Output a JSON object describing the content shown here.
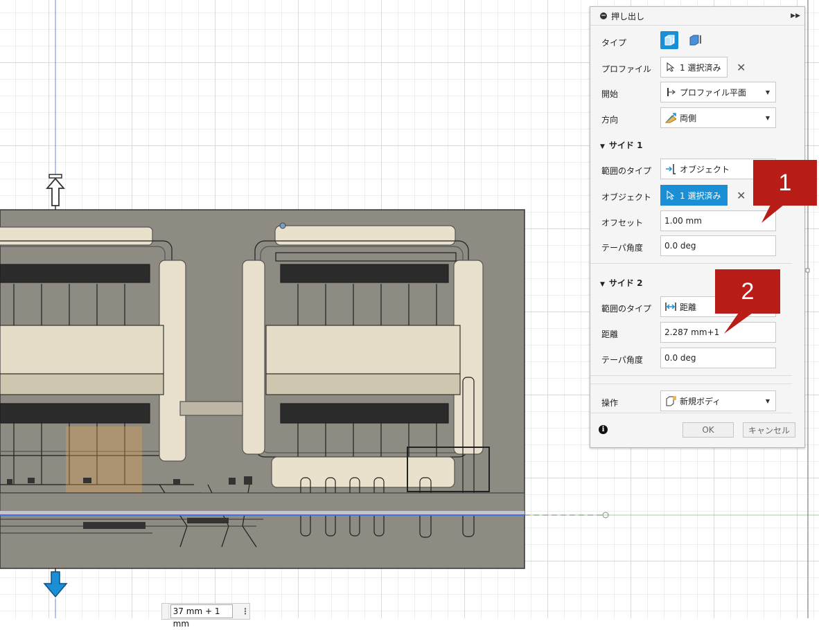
{
  "panel": {
    "title": "押し出し",
    "collapse_icon": "fast-forward-icon",
    "type_label": "タイプ",
    "profile_label": "プロファイル",
    "profile_value": "1 選択済み",
    "start_label": "開始",
    "start_value": "プロファイル平面",
    "direction_label": "方向",
    "direction_value": "両側",
    "side1": {
      "header": "サイド 1",
      "extent_type_label": "範囲のタイプ",
      "extent_type_value": "オブジェクト",
      "object_label": "オブジェクト",
      "object_value": "1 選択済み",
      "offset_label": "オフセット",
      "offset_value": "1.00 mm",
      "taper_label": "テーパ角度",
      "taper_value": "0.0 deg"
    },
    "side2": {
      "header": "サイド 2",
      "extent_type_label": "範囲のタイプ",
      "extent_type_value": "距離",
      "distance_label": "距離",
      "distance_value": "2.287 mm+1",
      "taper_label": "テーパ角度",
      "taper_value": "0.0 deg"
    },
    "operation_label": "操作",
    "operation_value": "新規ボディ",
    "ok_label": "OK",
    "cancel_label": "キャンセル"
  },
  "canvas": {
    "dimension_input": "37 mm + 1 mm"
  },
  "callouts": [
    "1",
    "2"
  ],
  "colors": {
    "accent": "#1a8fd6",
    "callout": "#b81d17",
    "body": "#8f8c83",
    "axis_blue": "#4470d8",
    "axis_green": "#7cd67c"
  }
}
